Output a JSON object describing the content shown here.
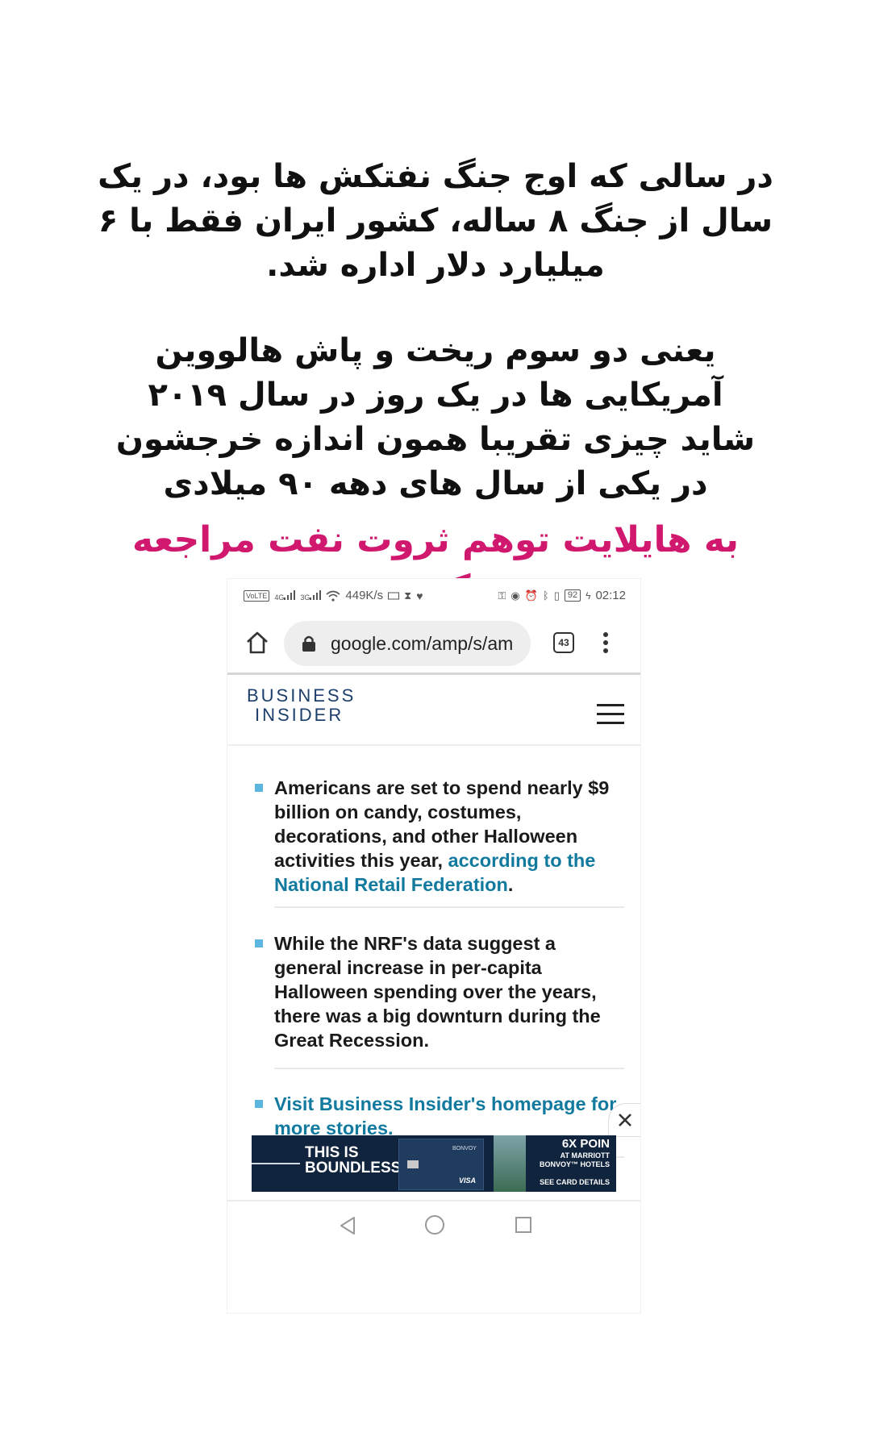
{
  "caption": {
    "paragraph1": "در سالی که اوج جنگ نفتکش ها بود، در یک سال از جنگ ۸ ساله، کشور ایران فقط با ۶ میلیارد دلار اداره شد.",
    "paragraph2_line1": "یعنی دو سوم ریخت و پاش هالووین آمریکایی ها در یک روز در سال ۲۰۱۹",
    "paragraph2_line2": "شاید چیزی تقریبا همون اندازه خرجشون در یکی از سال های دهه ۹۰ میلادی",
    "highlight": "به هایلایت توهم ثروت نفت مراجعه کنید",
    "highlight_color": "#d0186e"
  },
  "status_bar": {
    "net_speed": "449K/s",
    "battery": "92",
    "time": "02:12",
    "volte": "VoLTE",
    "net1": "4G",
    "net2": "3G"
  },
  "browser": {
    "url": "google.com/amp/s/am",
    "tab_count": "43"
  },
  "site": {
    "logo_line1": "BUSINESS",
    "logo_line2": "INSIDER",
    "brand_color": "#1c3f6b",
    "accent_color": "#5cb7e0",
    "link_color": "#117a9e"
  },
  "bullets": {
    "b1_text": "Americans are set to spend nearly $9 billion on candy, costumes, decorations, and other Halloween activities this year, ",
    "b1_link": "according to the National Retail Federation",
    "b1_end": ".",
    "b2_text": "While the NRF's data suggest a general increase in per-capita Halloween spending over the years, there was a big downturn during the Great Recession.",
    "b3_link": "Visit Business Insider's homepage for more stories."
  },
  "ad": {
    "headline_line1": "THIS IS",
    "headline_line2": "BOUNDLESS",
    "card_brand": "BONVOY",
    "card_network": "VISA",
    "points": "6X POIN",
    "subtext_line1": "AT MARRIOTT",
    "subtext_line2": "BONVOY™ HOTELS",
    "cta": "SEE CARD DETAILS"
  }
}
